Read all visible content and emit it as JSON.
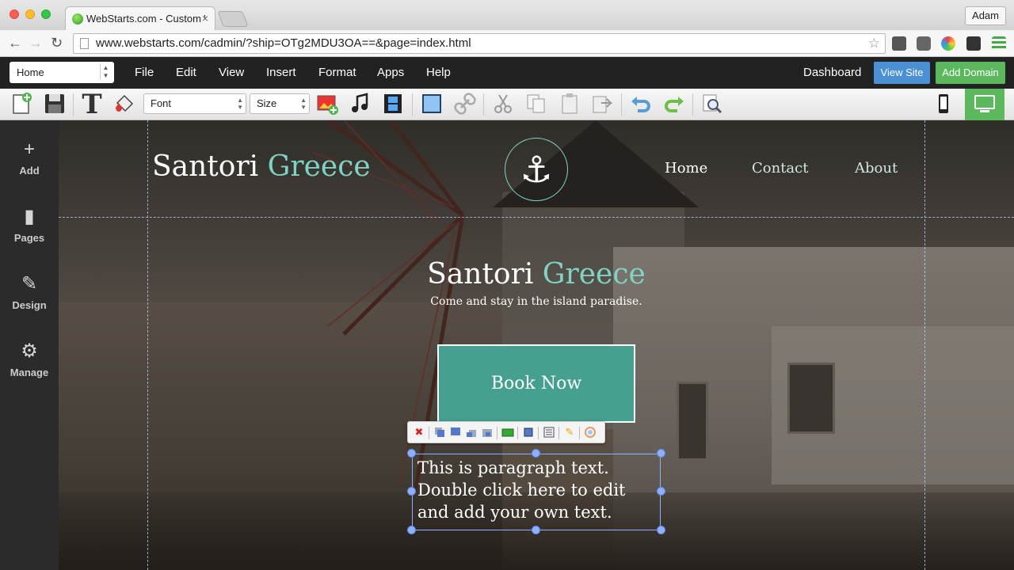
{
  "browser": {
    "tab_title": "WebStarts.com - Custom W",
    "tab_close": "×",
    "user": "Adam",
    "url": "www.webstarts.com/cadmin/?ship=OTg2MDU3OA==&page=index.html",
    "back": "←",
    "forward": "→",
    "reload": "↻",
    "star": "☆"
  },
  "menubar": {
    "page_select": "Home",
    "items": [
      "File",
      "Edit",
      "View",
      "Insert",
      "Format",
      "Apps",
      "Help"
    ],
    "dashboard": "Dashboard",
    "view_site": "View Site",
    "add_domain": "Add Domain"
  },
  "toolbar": {
    "font_select": "Font",
    "size_select": "Size",
    "text_tool_glyph": "T"
  },
  "sidebar": {
    "items": [
      {
        "label": "Add",
        "icon": "+"
      },
      {
        "label": "Pages",
        "icon": "▮"
      },
      {
        "label": "Design",
        "icon": "✎"
      },
      {
        "label": "Manage",
        "icon": "⚙"
      }
    ]
  },
  "site": {
    "logo_main": "Santori ",
    "logo_accent": "Greece",
    "anchor_icon": "⚓",
    "nav": [
      "Home",
      "Contact",
      "About"
    ],
    "hero_title_main": "Santori ",
    "hero_title_accent": "Greece",
    "hero_subtitle": "Come and stay in the island paradise.",
    "book_button": "Book Now",
    "paragraph_lines": [
      "This is paragraph text.",
      "Double click here to edit",
      "and add your own text."
    ]
  },
  "colors": {
    "accent": "#7fd3c5",
    "book_button": "#45a08f",
    "view_site": "#4a90d2",
    "add_domain": "#5cb85c"
  }
}
